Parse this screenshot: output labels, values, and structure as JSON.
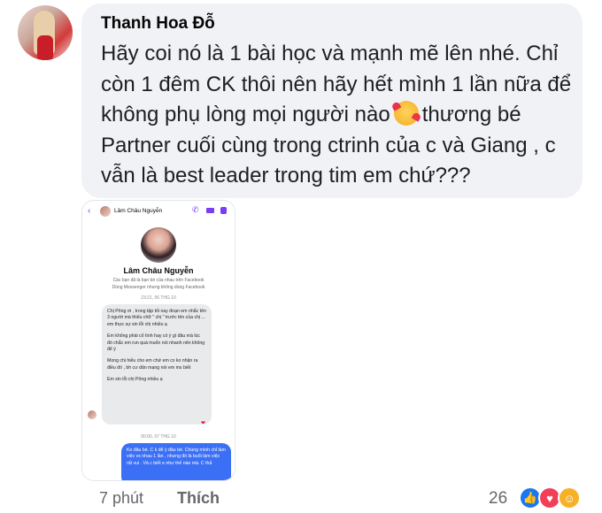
{
  "comment": {
    "author": "Thanh Hoa Đỗ",
    "text_before_emoji": "Hãy coi nó là 1 bài học và mạnh mẽ lên nhé. Chỉ còn 1 đêm CK thôi nên hãy hết mình 1 lần nữa để không phụ lòng mọi người nào",
    "text_after_emoji": "thương bé Partner cuối cùng trong ctrinh của c và Giang , c vẫn là best leader trong tim em chứ???",
    "time": "7 phút",
    "like_action": "Thích",
    "reaction_count": "26",
    "emoji": "smiling-face-with-hearts"
  },
  "screenshot": {
    "chat_title": "Lâm Châu Nguyễn",
    "profile_name": "Lâm Châu Nguyễn",
    "friends_note": "Các bạn đã là bạn bè của nhau trên Facebook",
    "messenger_note": "Dùng Messenger nhưng không dùng Facebook",
    "time_1": "23:21, 06 THG 10",
    "received_paragraphs": [
      "Chị Pông ơi , trong tập tối nay đoạn em nhắc tên 3 người mà thiếu chữ \" chị \" trước tên của chị ... em thực sự xin lỗi chị nhiều ạ",
      "Em không phải cố tình hay có ý gì đâu mà lúc đó chắc em run quá muốn nói nhanh nên không để ý",
      "Mong chị hiểu cho em chứ em cx ko nhận ra điều đó , bh cư dân mạng nói em ms biết",
      "Em xin lỗi chị Pông nhiều ạ"
    ],
    "time_2": "00:00, 07 THG 10",
    "sent_message": "Ko đâu bé. C k để ý đâu bé. Chúng mình chỉ làm việc vs nhau 1 lần , nhưng đó là buổi làm việc rất vui . Và c biết e như thế nào mà. C thấ"
  }
}
